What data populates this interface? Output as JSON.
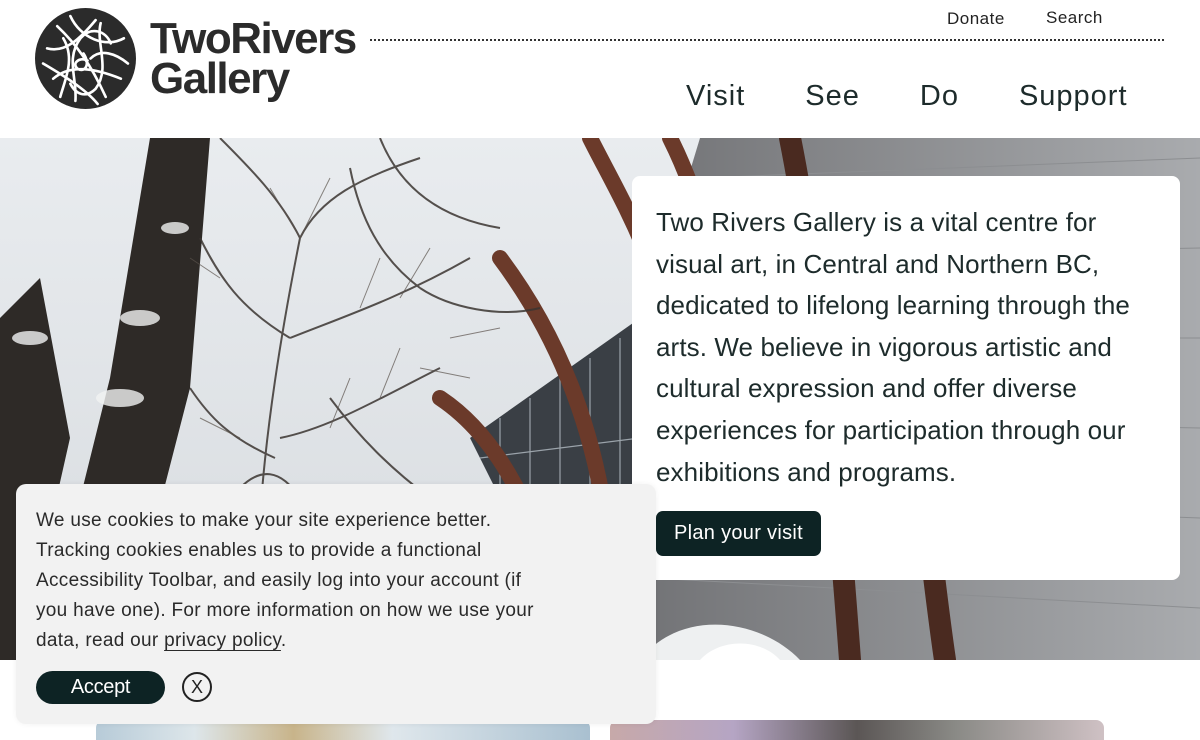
{
  "site": {
    "logo_line1": "TwoRivers",
    "logo_line2": "Gallery"
  },
  "utility_nav": {
    "donate": "Donate",
    "search": "Search"
  },
  "main_nav": {
    "items": [
      {
        "label": "Visit"
      },
      {
        "label": "See"
      },
      {
        "label": "Do"
      },
      {
        "label": "Support"
      }
    ]
  },
  "hero": {
    "intro": "Two Rivers Gallery is a vital centre for visual art, in Central and Northern BC, dedicated to lifelong learning through the arts. We believe in vigorous artistic and cultural expression and offer diverse experiences for participation through our exhibitions and programs.",
    "cta_label": "Plan your visit"
  },
  "cookie_banner": {
    "text_before_link": "We use cookies to make your site experience better. Tracking cookies enables us to provide a functional Accessibility Toolbar, and easily log into your account (if you have one). For more information on how we use your data, read our ",
    "link_text": "privacy policy",
    "text_after_link": ".",
    "accept_label": "Accept",
    "close_label": "X"
  },
  "colors": {
    "brand_dark": "#0d2324",
    "text": "#1d2b2b",
    "banner_bg": "#f2f2f2"
  }
}
